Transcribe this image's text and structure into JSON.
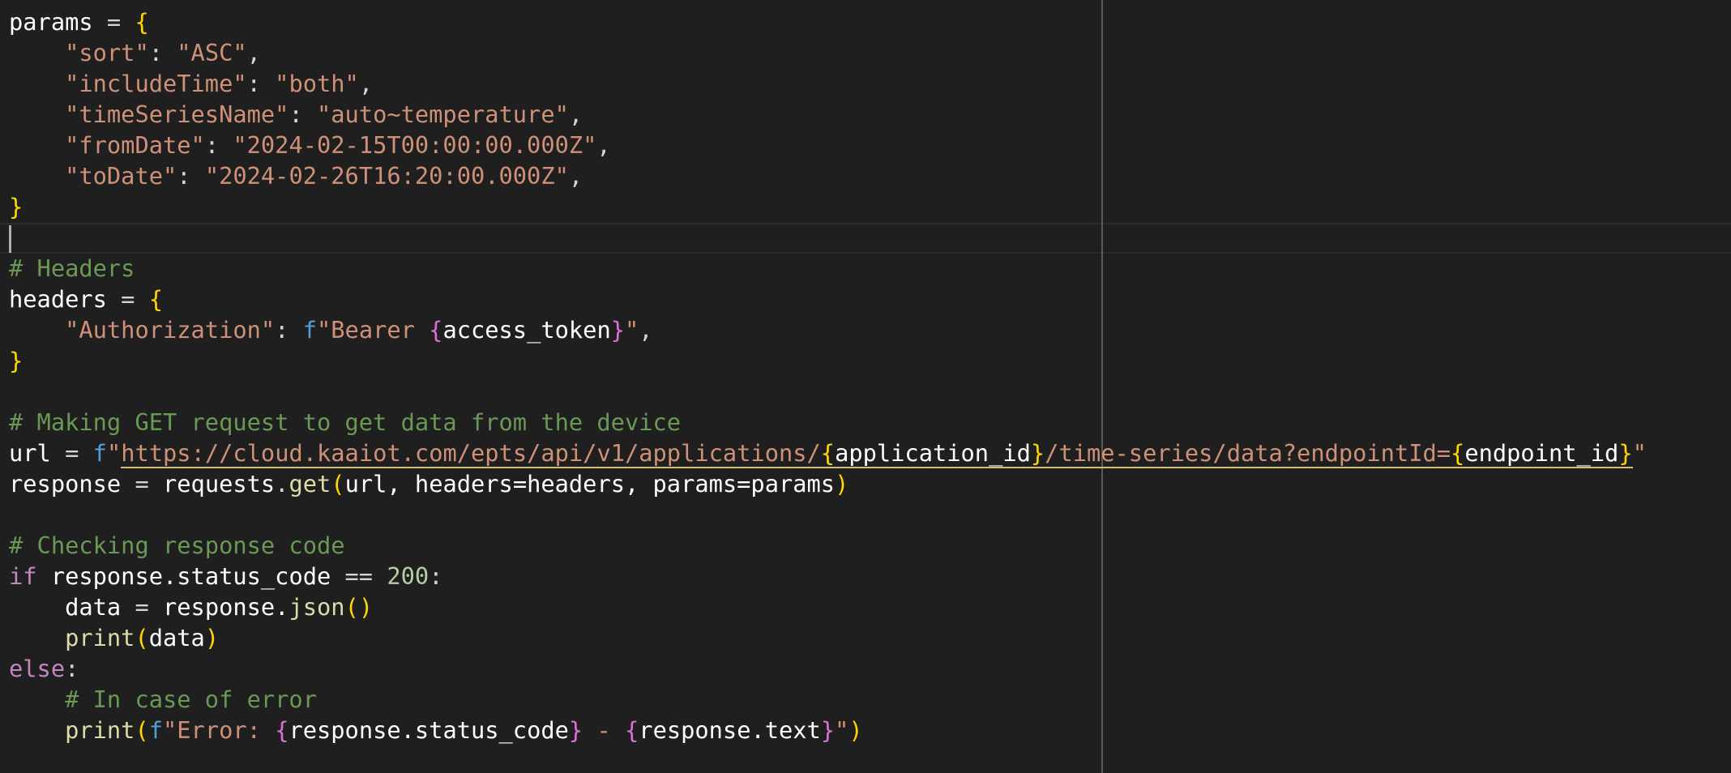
{
  "code": {
    "l1": {
      "name": "params",
      "eq": " = ",
      "open": "{"
    },
    "l2": {
      "key": "\"sort\"",
      "colon": ": ",
      "val": "\"ASC\"",
      "comma": ","
    },
    "l3": {
      "key": "\"includeTime\"",
      "colon": ": ",
      "val": "\"both\"",
      "comma": ","
    },
    "l4": {
      "key": "\"timeSeriesName\"",
      "colon": ": ",
      "val": "\"auto~temperature\"",
      "comma": ","
    },
    "l5": {
      "key": "\"fromDate\"",
      "colon": ": ",
      "val": "\"2024-02-15T00:00:00.000Z\"",
      "comma": ","
    },
    "l6": {
      "key": "\"toDate\"",
      "colon": ": ",
      "val": "\"2024-02-26T16:20:00.000Z\"",
      "comma": ","
    },
    "l7": {
      "close": "}"
    },
    "l9": {
      "comment": "# Headers"
    },
    "l10": {
      "name": "headers",
      "eq": " = ",
      "open": "{"
    },
    "l11": {
      "key": "\"Authorization\"",
      "colon": ": ",
      "fpre": "f",
      "s1": "\"Bearer ",
      "lb": "{",
      "expr": "access_token",
      "rb": "}",
      "s2": "\"",
      "comma": ","
    },
    "l12": {
      "close": "}"
    },
    "l14": {
      "comment": "# Making GET request to get data from the device"
    },
    "l15": {
      "name": "url",
      "eq": " = ",
      "fpre": "f",
      "q": "\"",
      "s1": "https://cloud.kaaiot.com/epts/api/v1/applications/",
      "lb1": "{",
      "e1": "application_id",
      "rb1": "}",
      "s2": "/time-series/data?endpointId=",
      "lb2": "{",
      "e2": "endpoint_id",
      "rb2": "}",
      "q2": "\""
    },
    "l16": {
      "name": "response",
      "eq": " = ",
      "obj": "requests",
      "dot": ".",
      "fn": "get",
      "open": "(",
      "args": "url, headers=headers, params=params",
      "close": ")"
    },
    "l18": {
      "comment": "# Checking response code"
    },
    "l19": {
      "kw": "if",
      "sp": " ",
      "expr": "response.status_code",
      "op": " == ",
      "num": "200",
      "colon": ":"
    },
    "l20": {
      "name": "data",
      "eq": " = ",
      "obj": "response.",
      "fn": "json",
      "parens": "()"
    },
    "l21": {
      "fn": "print",
      "open": "(",
      "arg": "data",
      "close": ")"
    },
    "l22": {
      "kw": "else",
      "colon": ":"
    },
    "l23": {
      "comment": "# In case of error"
    },
    "l24": {
      "fn": "print",
      "open": "(",
      "fpre": "f",
      "s1": "\"Error: ",
      "lb1": "{",
      "e1": "response.status_code",
      "rb1": "}",
      "mid": " - ",
      "lb2": "{",
      "e2": "response.text",
      "rb2": "}",
      "s2": "\"",
      "close": ")"
    }
  },
  "colors": {
    "background": "#1f1f1f",
    "string": "#ce9178",
    "comment": "#6a9955",
    "keyword": "#c586c0",
    "function": "#dcdcaa",
    "bracket": "#ffd700",
    "number": "#b5cea8"
  }
}
